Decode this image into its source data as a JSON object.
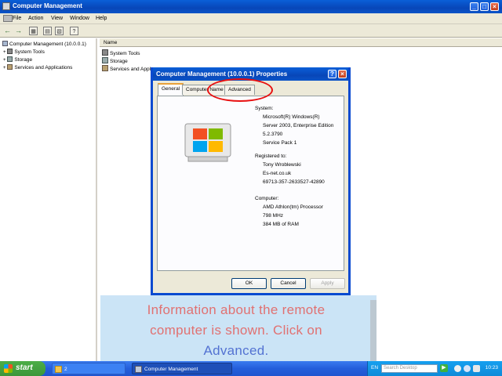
{
  "window": {
    "title": "Computer Management",
    "controls": [
      "_",
      "□",
      "×"
    ]
  },
  "menu": [
    "File",
    "Action",
    "View",
    "Window",
    "Help"
  ],
  "tree": {
    "root": "Computer Management (10.0.0.1)",
    "children": [
      "System Tools",
      "Storage",
      "Services and Applications"
    ]
  },
  "list": {
    "column": "Name",
    "items": [
      "System Tools",
      "Storage",
      "Services and Appl"
    ]
  },
  "dialog": {
    "title": "Computer Management (10.0.0.1) Properties",
    "tabs": [
      "General",
      "Computer Name",
      "Advanced"
    ],
    "system_label": "System:",
    "system": [
      "Microsoft(R) Windows(R)",
      "Server 2003, Enterprise Edition",
      "5.2.3790",
      "Service Pack 1"
    ],
    "registered_label": "Registered to:",
    "registered": [
      "Tony Wroblewski",
      "Es-net.co.uk",
      "69713-357-2633527-42890"
    ],
    "computer_label": "Computer:",
    "computer": [
      "AMD Athlon(tm) Processor",
      "798 MHz",
      "384 MB of RAM"
    ],
    "buttons": {
      "ok": "OK",
      "cancel": "Cancel",
      "apply": "Apply"
    }
  },
  "caption": {
    "line1": "Information about the remote",
    "line2": "computer is shown. Click on",
    "line3": "Advanced."
  },
  "taskbar": {
    "start": "start",
    "tasks": [
      "2",
      "Computer Management"
    ],
    "lang": "EN",
    "search_placeholder": "Search Desktop",
    "clock": "10:23"
  },
  "colors": {
    "titlebar": "#0846b8",
    "highlight": "#e81010",
    "caption_bg": "#c9e3f6",
    "caption_text": "#e06a6a"
  }
}
